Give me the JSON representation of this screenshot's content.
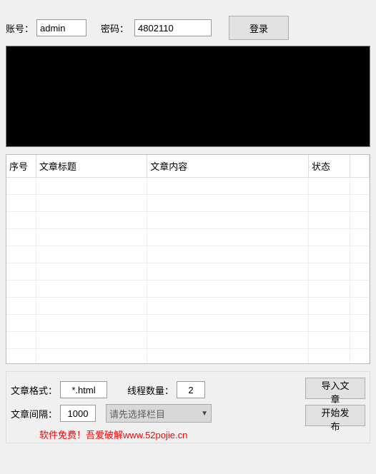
{
  "login": {
    "account_label": "账号：",
    "account_value": "admin",
    "password_label": "密码：",
    "password_value": "4802110",
    "login_button": "登录"
  },
  "table": {
    "columns": {
      "seq": "序号",
      "title": "文章标题",
      "content": "文章内容",
      "status": "状态"
    }
  },
  "bottom": {
    "format_label": "文章格式：",
    "format_value": "*.html",
    "thread_label": "线程数量：",
    "thread_value": "2",
    "interval_label": "文章间隔：",
    "interval_value": "1000",
    "category_placeholder": "请先选择栏目",
    "import_button": "导入文章",
    "start_button": "开始发布"
  },
  "footer": {
    "text_prefix": "软件免费！吾爱破解",
    "url": "www.52pojie.cn"
  }
}
